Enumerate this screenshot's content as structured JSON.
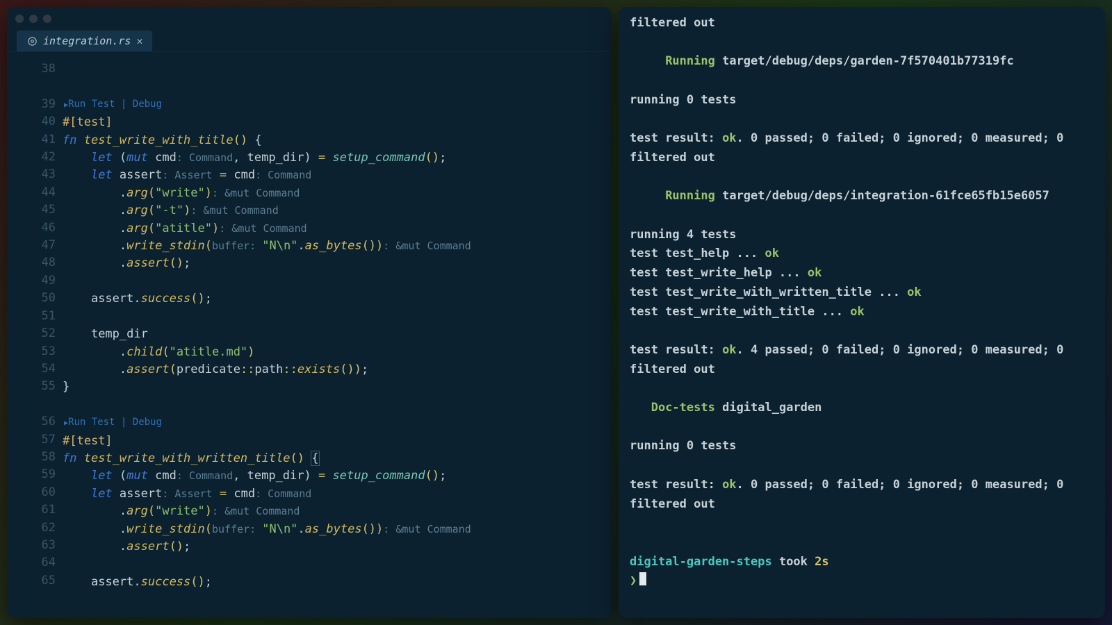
{
  "editor": {
    "tab": {
      "filename": "integration.rs",
      "icon_name": "rust-file-icon"
    },
    "codelens": {
      "run": "Run Test",
      "debug": "Debug"
    },
    "line_numbers": [
      "38",
      "",
      "39",
      "40",
      "41",
      "42",
      "43",
      "44",
      "45",
      "46",
      "47",
      "48",
      "49",
      "50",
      "51",
      "52",
      "53",
      "54",
      "55",
      "",
      "56",
      "57",
      "58",
      "59",
      "60",
      "61",
      "62",
      "63",
      "64",
      "65"
    ],
    "tokens": {
      "attr_test": "#[test]",
      "kw_fn": "fn",
      "kw_let": "let",
      "kw_mut": "mut",
      "fn1_name": "test_write_with_title",
      "fn2_name": "test_write_with_written_title",
      "ident_cmd": "cmd",
      "ident_assert": "assert",
      "ident_temp_dir": "temp_dir",
      "hint_command": ": Command",
      "hint_assert": ": Assert",
      "hint_mut_command": ": &mut Command",
      "hint_buffer": "buffer: ",
      "call_setup_command": "setup_command",
      "call_arg": "arg",
      "call_write_stdin": "write_stdin",
      "call_as_bytes": "as_bytes",
      "call_assert": "assert",
      "call_success": "success",
      "call_child": "child",
      "ident_predicate": "predicate",
      "ident_path": "path",
      "call_exists": "exists",
      "str_write": "\"write\"",
      "str_dash_t": "\"-t\"",
      "str_atitle": "\"atitle\"",
      "str_Nn": "\"N\\n\"",
      "str_atitle_md": "\"atitle.md\""
    }
  },
  "terminal": {
    "l0": "filtered out",
    "running_label": "Running",
    "target1": "target/debug/deps/garden-7f570401b77319fc",
    "running0": "running 0 tests",
    "result_prefix": "test result: ",
    "ok": "ok",
    "result0_suffix": ". 0 passed; 0 failed; 0 ignored; 0 measured; 0",
    "filtered": "filtered out",
    "target2": "target/debug/deps/integration-61fce65fb15e6057",
    "running4": "running 4 tests",
    "t1": "test test_help ... ",
    "t2": "test test_write_help ... ",
    "t3": "test test_write_with_written_title ... ",
    "t4": "test test_write_with_title ... ",
    "result4_suffix": ". 4 passed; 0 failed; 0 ignored; 0 measured; 0",
    "doctests_label": "Doc-tests",
    "doctests_target": "digital_garden",
    "prompt_path": "digital-garden-steps",
    "prompt_took": "took ",
    "prompt_time": "2s",
    "prompt_char": "❯"
  }
}
